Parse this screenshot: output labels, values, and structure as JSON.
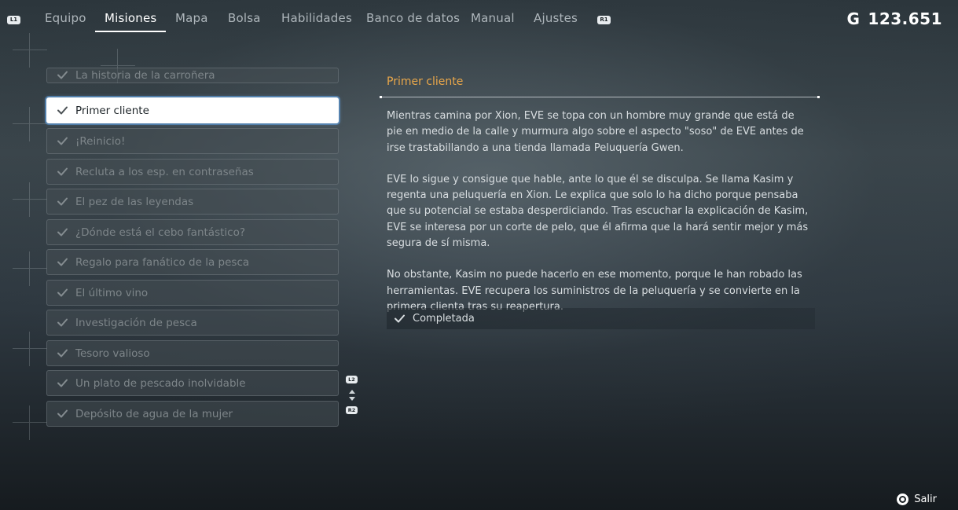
{
  "topbar": {
    "left_button": "L1",
    "right_button": "R1",
    "tabs": [
      {
        "label": "Equipo",
        "active": false
      },
      {
        "label": "Misiones",
        "active": true
      },
      {
        "label": "Mapa",
        "active": false
      },
      {
        "label": "Bolsa",
        "active": false
      },
      {
        "label": "Habilidades",
        "active": false
      },
      {
        "label": "Banco de datos",
        "active": false
      },
      {
        "label": "Manual",
        "active": false
      },
      {
        "label": "Ajustes",
        "active": false
      }
    ],
    "currency_symbol": "G",
    "currency_amount": "123.651"
  },
  "quests": {
    "items": [
      {
        "label": "La historia de la carroñera",
        "completed": true
      },
      {
        "label": "Primer cliente",
        "completed": true,
        "selected": true
      },
      {
        "label": "¡Reinicio!",
        "completed": true
      },
      {
        "label": "Recluta a los esp. en contraseñas",
        "completed": true
      },
      {
        "label": "El pez de las leyendas",
        "completed": true
      },
      {
        "label": "¿Dónde está el cebo fantástico?",
        "completed": true
      },
      {
        "label": "Regalo para fanático de la pesca",
        "completed": true
      },
      {
        "label": "El último vino",
        "completed": true
      },
      {
        "label": "Investigación de pesca",
        "completed": true
      },
      {
        "label": "Tesoro valioso",
        "completed": true
      },
      {
        "label": "Un plato de pescado inolvidable",
        "completed": true
      },
      {
        "label": "Depósito de agua de la mujer",
        "completed": true
      }
    ],
    "scroll_up_button": "L2",
    "scroll_down_button": "R2"
  },
  "detail": {
    "title": "Primer cliente",
    "paragraphs": [
      "Mientras camina por Xion, EVE se topa con un hombre muy grande que está de pie en medio de la calle y murmura algo sobre el aspecto \"soso\" de EVE antes de irse trastabillando a una tienda llamada Peluquería Gwen.",
      "EVE lo sigue y consigue que hable, ante lo que él se disculpa. Se llama Kasim y regenta una peluquería en Xion. Le explica que solo lo ha dicho porque pensaba que su potencial se estaba desperdiciando. Tras escuchar la explicación de Kasim, EVE se interesa por un corte de pelo, que él afirma que la hará sentir mejor y más segura de sí misma.",
      "No obstante, Kasim no puede hacerlo en ese momento, porque le han robado las herramientas. EVE recupera los suministros de la peluquería y se convierte en la primera clienta tras su reapertura."
    ],
    "status": "Completada"
  },
  "footer": {
    "exit_label": "Salir"
  },
  "colors": {
    "accent_title": "#e9a74a",
    "selected_bg": "#ffffff",
    "selected_glow": "#5a96d2"
  }
}
